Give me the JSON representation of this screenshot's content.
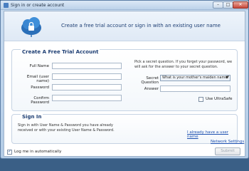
{
  "window": {
    "title": "Sign in or create account",
    "min_glyph": "–",
    "max_glyph": "□",
    "close_glyph": "✕"
  },
  "header": {
    "text": "Create a free trial account or sign in with an existing user name"
  },
  "trial": {
    "title": "Create A Free Trial Account",
    "full_name_label": "Full Name",
    "email_label": "Email (user name)",
    "password_label": "Password",
    "confirm_label": "Confirm Password",
    "secret_note": "Pick a secret question. If you forget your password, we will ask for the answer to your secret question.",
    "secret_label": "Secret Question",
    "secret_value": "What is your mother's maiden name?",
    "answer_label": "Answer",
    "ultrasafe_label": "Use UltraSafe"
  },
  "signin": {
    "title": "Sign In",
    "note": "Sign in with User Name & Password you have already received or with your existing User Name & Password.",
    "link": "I already have a user name"
  },
  "footer": {
    "log_me_in_label": "Log me in automatically",
    "log_me_in_checked": true,
    "network_settings": "Network Settings",
    "submit": "Submit"
  },
  "icons": {
    "logo": "cloud-lock-icon",
    "window": "app-icon"
  }
}
